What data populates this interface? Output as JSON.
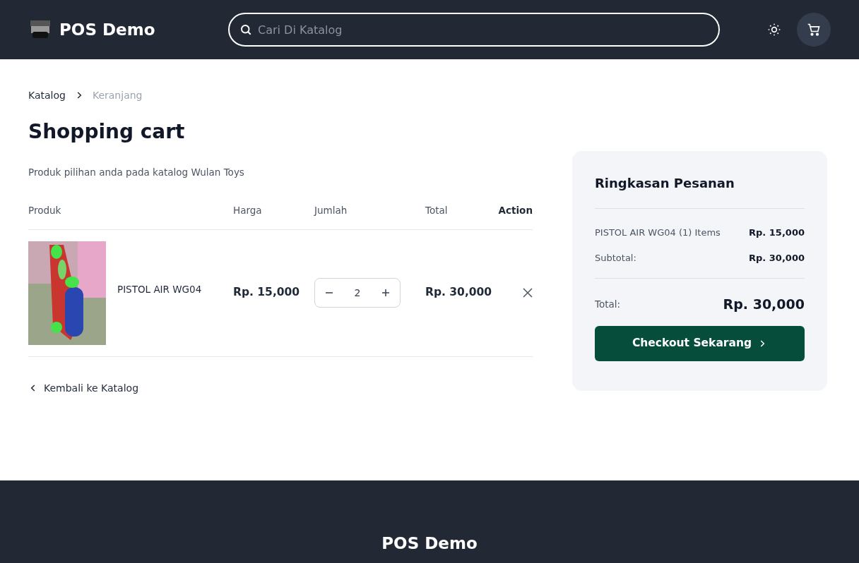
{
  "header": {
    "brand": "POS Demo",
    "search": {
      "placeholder": "Cari Di Katalog"
    }
  },
  "breadcrumb": [
    {
      "label": "Katalog",
      "current": false
    },
    {
      "label": "Keranjang",
      "current": true
    }
  ],
  "title": "Shopping cart",
  "subtitle": "Produk pilihan anda pada katalog Wulan Toys",
  "table": {
    "columns": [
      "Produk",
      "Harga",
      "Jumlah",
      "Total",
      "Action"
    ],
    "rows": [
      {
        "name": "PISTOL AIR WG04",
        "price": "Rp. 15,000",
        "quantity": "2",
        "total": "Rp. 30,000"
      }
    ]
  },
  "back_link": "Kembali ke Katalog",
  "summary": {
    "title": "Ringkasan Pesanan",
    "lines": [
      {
        "label": "PISTOL AIR WG04 (1) Items",
        "value": "Rp. 15,000"
      },
      {
        "label": "Subtotal:",
        "value": "Rp. 30,000"
      }
    ],
    "total_label": "Total:",
    "total_value": "Rp. 30,000",
    "checkout": "Checkout Sekarang"
  },
  "footer": {
    "brand": "POS Demo"
  }
}
